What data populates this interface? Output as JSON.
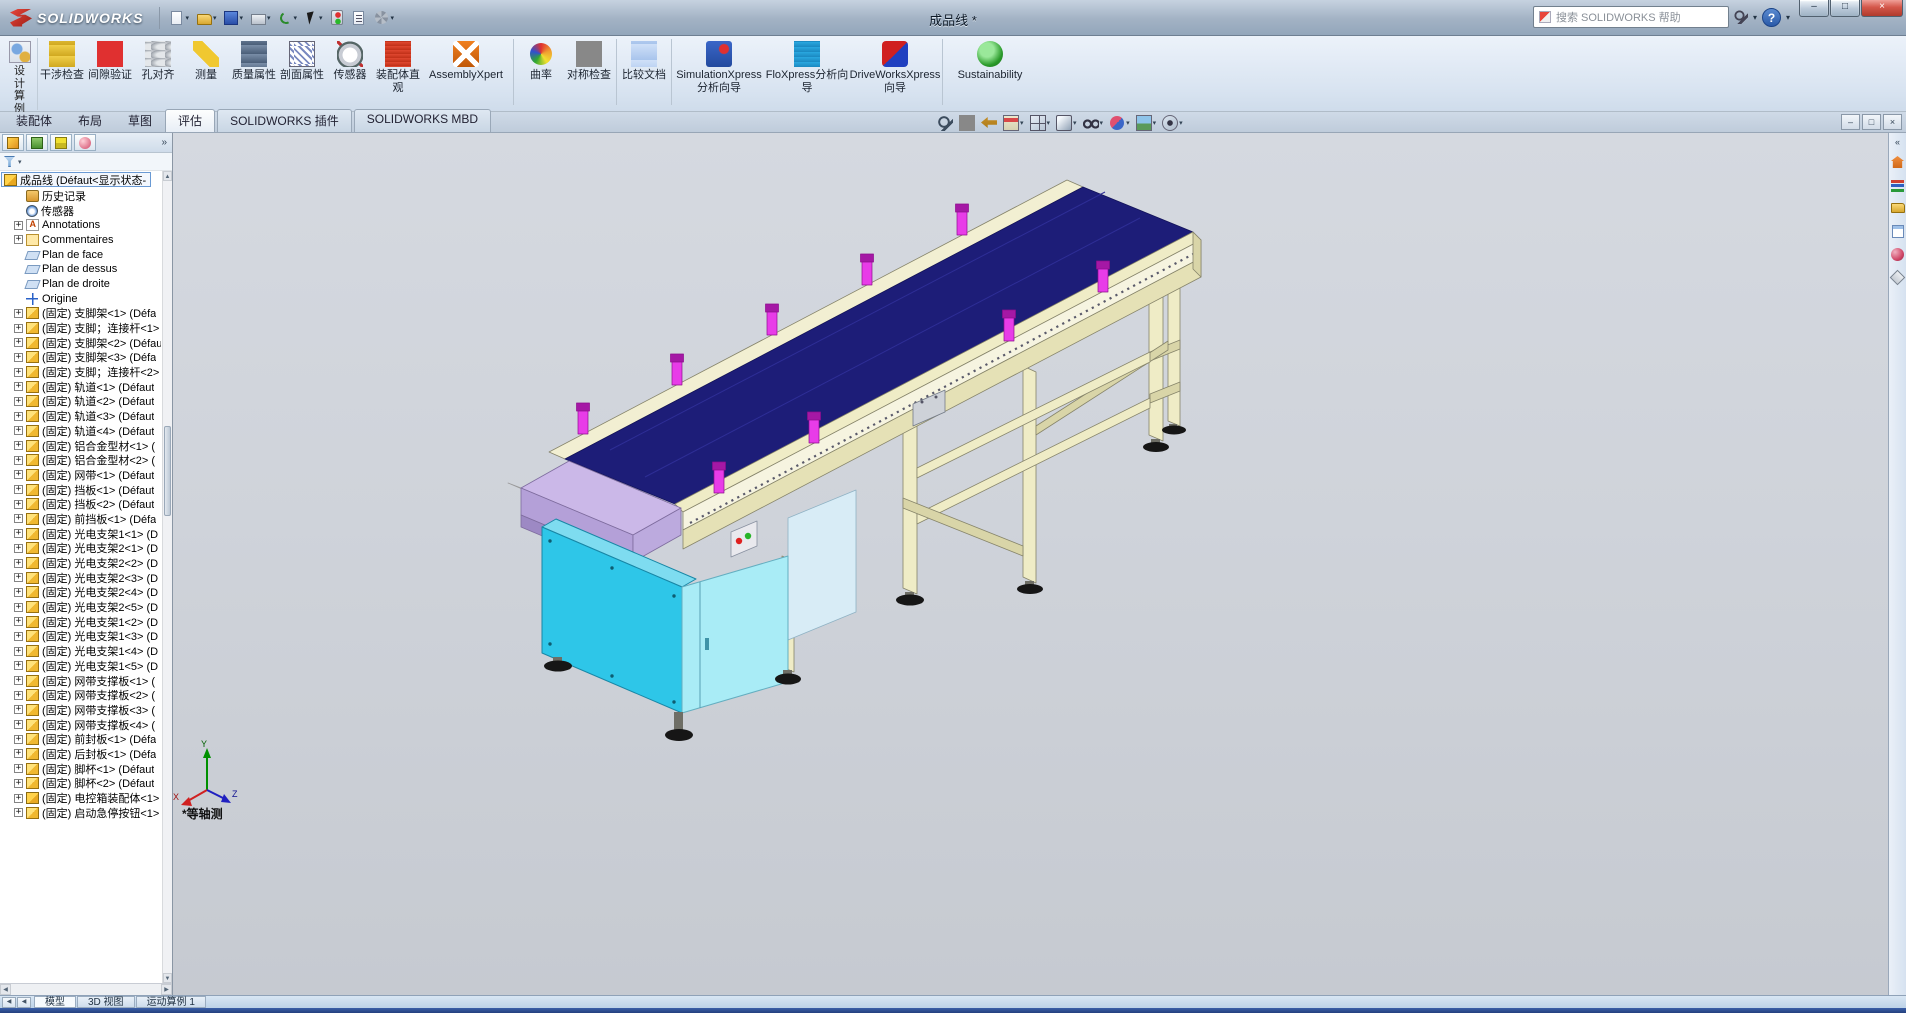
{
  "app": {
    "logo": "SOLIDWORKS",
    "title": "成品线 *",
    "search_placeholder": "搜索 SOLIDWORKS 帮助",
    "help_glyph": "?"
  },
  "titlebar": {
    "tools": [
      {
        "name": "new",
        "arrow": true
      },
      {
        "name": "open",
        "arrow": true
      },
      {
        "name": "save",
        "arrow": true
      },
      {
        "name": "print",
        "arrow": true
      },
      {
        "name": "undo",
        "arrow": true
      },
      {
        "name": "select",
        "arrow": true
      },
      {
        "name": "rebuild",
        "arrow": false
      },
      {
        "name": "file-properties",
        "arrow": false
      },
      {
        "name": "options",
        "arrow": true
      }
    ],
    "window_buttons": [
      {
        "name": "minimize",
        "glyph": "–"
      },
      {
        "name": "maximize",
        "glyph": "□"
      },
      {
        "name": "close",
        "glyph": "×"
      }
    ]
  },
  "ribbon": {
    "design_study_label": "设计算例",
    "buttons": [
      {
        "icon": "interference",
        "label": "干涉检查"
      },
      {
        "icon": "clearance",
        "label": "间隙验证"
      },
      {
        "icon": "hole-align",
        "label": "孔对齐"
      },
      {
        "icon": "measure",
        "label": "测量"
      },
      {
        "icon": "mass-props",
        "label": "质量属性"
      },
      {
        "icon": "section-props",
        "label": "剖面属性"
      },
      {
        "icon": "sensor",
        "label": "传感器"
      },
      {
        "icon": "assembly-visual",
        "label": "装配体直观"
      },
      {
        "icon": "assemblyxpert",
        "label": "AssemblyXpert",
        "wide": true
      },
      {
        "sep": true
      },
      {
        "icon": "curvature",
        "label": "曲率"
      },
      {
        "icon": "symmetry",
        "label": "对称检查"
      },
      {
        "sep": true
      },
      {
        "icon": "compare",
        "label": "比较文档"
      },
      {
        "sep": true
      },
      {
        "icon": "simulationxpress",
        "label": "SimulationXpress分析向导",
        "wide": true
      },
      {
        "icon": "floxpress",
        "label": "FloXpress分析向导",
        "wide": true
      },
      {
        "icon": "driveworksxpress",
        "label": "DriveWorksXpress向导",
        "wide": true
      },
      {
        "sep": true
      },
      {
        "icon": "sustainability",
        "label": "Sustainability",
        "wide": true
      }
    ]
  },
  "tabs": {
    "items": [
      {
        "label": "装配体"
      },
      {
        "label": "布局"
      },
      {
        "label": "草图"
      },
      {
        "label": "评估",
        "active": true
      },
      {
        "label": "SOLIDWORKS 插件",
        "addin": true
      },
      {
        "label": "SOLIDWORKS MBD",
        "addin": true
      }
    ]
  },
  "headsup": [
    {
      "name": "zoom-fit"
    },
    {
      "name": "zoom-area"
    },
    {
      "name": "previous-view"
    },
    {
      "name": "section-view",
      "arrow": true
    },
    {
      "name": "view-orientation",
      "arrow": true
    },
    {
      "name": "display-style",
      "arrow": true
    },
    {
      "name": "hide-show-items",
      "arrow": true
    },
    {
      "name": "edit-appearance",
      "arrow": true
    },
    {
      "name": "apply-scene",
      "arrow": true
    },
    {
      "name": "view-settings",
      "arrow": true
    }
  ],
  "document_window_buttons": [
    {
      "name": "doc-minimize",
      "glyph": "–"
    },
    {
      "name": "doc-restore",
      "glyph": "□"
    },
    {
      "name": "doc-close",
      "glyph": "×"
    }
  ],
  "panel": {
    "tabs": [
      "featuremanager",
      "propertymanager",
      "configurationmanager",
      "displaymanager"
    ],
    "overflow_glyph": "»",
    "tree": [
      {
        "i": "assembly",
        "t": "成品线 (Défaut<显示状态-",
        "root": true
      },
      {
        "i": "history",
        "t": "历史记录"
      },
      {
        "i": "sensor",
        "t": "传感器"
      },
      {
        "i": "annotations",
        "t": "Annotations",
        "e": 1
      },
      {
        "i": "comments",
        "t": "Commentaires",
        "e": 1
      },
      {
        "i": "plane",
        "t": "Plan de face"
      },
      {
        "i": "plane",
        "t": "Plan de dessus"
      },
      {
        "i": "plane",
        "t": "Plan de droite"
      },
      {
        "i": "origin",
        "t": "Origine"
      },
      {
        "i": "part",
        "e": 1,
        "t": "(固定) 支脚架<1> (Défa"
      },
      {
        "i": "part",
        "e": 1,
        "t": "(固定) 支脚；连接杆<1>"
      },
      {
        "i": "part",
        "e": 1,
        "t": "(固定) 支脚架<2> (Défau"
      },
      {
        "i": "part",
        "e": 1,
        "t": "(固定) 支脚架<3> (Défa"
      },
      {
        "i": "part",
        "e": 1,
        "t": "(固定) 支脚；连接杆<2>"
      },
      {
        "i": "part",
        "e": 1,
        "t": "(固定) 轨道<1> (Défaut"
      },
      {
        "i": "part",
        "e": 1,
        "t": "(固定) 轨道<2> (Défaut"
      },
      {
        "i": "part",
        "e": 1,
        "t": "(固定) 轨道<3> (Défaut"
      },
      {
        "i": "part",
        "e": 1,
        "t": "(固定) 轨道<4> (Défaut"
      },
      {
        "i": "part",
        "e": 1,
        "t": "(固定) 铝合金型材<1> ("
      },
      {
        "i": "part",
        "e": 1,
        "t": "(固定) 铝合金型材<2> ("
      },
      {
        "i": "part",
        "e": 1,
        "t": "(固定) 网带<1> (Défaut"
      },
      {
        "i": "part",
        "e": 1,
        "t": "(固定) 挡板<1> (Défaut"
      },
      {
        "i": "part",
        "e": 1,
        "t": "(固定) 挡板<2> (Défaut"
      },
      {
        "i": "part",
        "e": 1,
        "t": "(固定) 前挡板<1> (Défa"
      },
      {
        "i": "part",
        "e": 1,
        "t": "(固定) 光电支架1<1> (D"
      },
      {
        "i": "part",
        "e": 1,
        "t": "(固定) 光电支架2<1> (D"
      },
      {
        "i": "part",
        "e": 1,
        "t": "(固定) 光电支架2<2> (D"
      },
      {
        "i": "part",
        "e": 1,
        "t": "(固定) 光电支架2<3> (D"
      },
      {
        "i": "part",
        "e": 1,
        "t": "(固定) 光电支架2<4> (D"
      },
      {
        "i": "part",
        "e": 1,
        "t": "(固定) 光电支架2<5> (D"
      },
      {
        "i": "part",
        "e": 1,
        "t": "(固定) 光电支架1<2> (D"
      },
      {
        "i": "part",
        "e": 1,
        "t": "(固定) 光电支架1<3> (D"
      },
      {
        "i": "part",
        "e": 1,
        "t": "(固定) 光电支架1<4> (D"
      },
      {
        "i": "part",
        "e": 1,
        "t": "(固定) 光电支架1<5> (D"
      },
      {
        "i": "part",
        "e": 1,
        "t": "(固定) 网带支撑板<1> ("
      },
      {
        "i": "part",
        "e": 1,
        "t": "(固定) 网带支撑板<2> ("
      },
      {
        "i": "part",
        "e": 1,
        "t": "(固定) 网带支撑板<3> ("
      },
      {
        "i": "part",
        "e": 1,
        "t": "(固定) 网带支撑板<4> ("
      },
      {
        "i": "part",
        "e": 1,
        "t": "(固定) 前封板<1> (Défa"
      },
      {
        "i": "part",
        "e": 1,
        "t": "(固定) 后封板<1> (Défa"
      },
      {
        "i": "part",
        "e": 1,
        "t": "(固定) 脚杯<1> (Défaut"
      },
      {
        "i": "part",
        "e": 1,
        "t": "(固定) 脚杯<2> (Défaut"
      },
      {
        "i": "assembly",
        "e": 1,
        "t": "(固定) 电控箱装配体<1>"
      },
      {
        "i": "part",
        "e": 1,
        "t": "(固定) 启动急停按钮<1>"
      }
    ]
  },
  "viewport": {
    "orientation_label": "*等轴测",
    "triad": {
      "x": "X",
      "y": "Y",
      "z": "Z"
    }
  },
  "taskpane": [
    "resources",
    "design-library",
    "file-explorer",
    "view-palette",
    "appearances",
    "custom-properties"
  ],
  "bottombar": {
    "scroll_glyphs": [
      "◀",
      "◀"
    ],
    "tabs": [
      {
        "label": "模型",
        "active": true
      },
      {
        "label": "3D 视图"
      },
      {
        "label": "运动算例 1"
      }
    ]
  },
  "model": {
    "colors": {
      "frame": "#efecc6",
      "frame_dark": "#d9d5a8",
      "belt": "#1d1d78",
      "belt_highlight": "#2e2e96",
      "head_top": "#cbb8e8",
      "head_front": "#b4a0d8",
      "box_front": "#2ec6e8",
      "box_side": "#a9ecf6",
      "sensor": "#e83ce8",
      "sensor_cap": "#a518a5",
      "foot": "#161616",
      "rear_panel": "#d8ecf6"
    }
  }
}
